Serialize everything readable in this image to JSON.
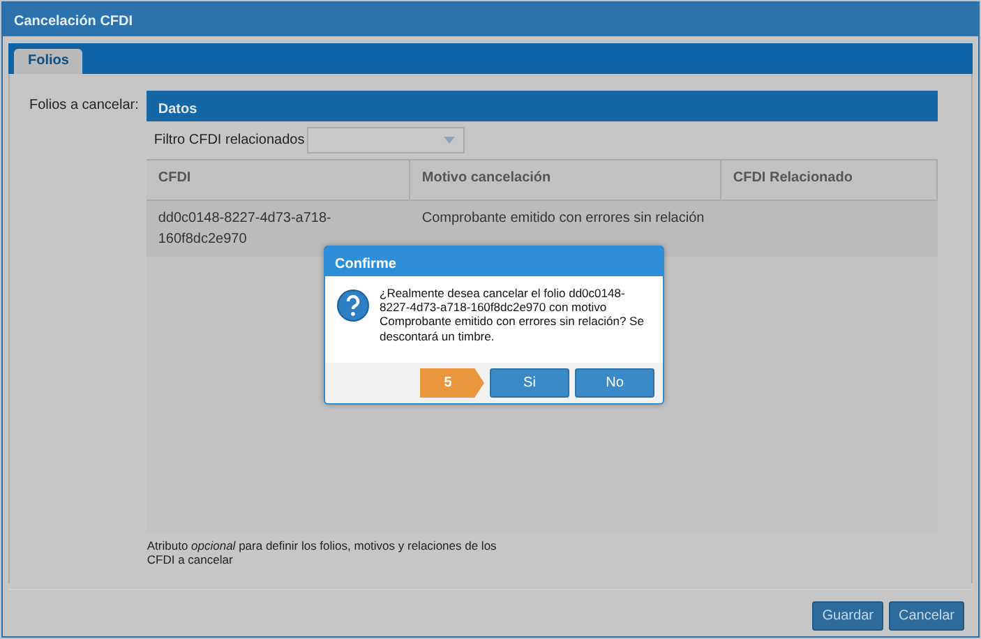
{
  "window": {
    "title": "Cancelación CFDI"
  },
  "tabs": [
    {
      "label": "Folios",
      "selected": true
    }
  ],
  "field_label": "Folios a cancelar:",
  "panel": {
    "title": "Datos",
    "filter": {
      "label": "Filtro CFDI relacionados"
    },
    "table": {
      "columns": [
        "CFDI",
        "Motivo cancelación",
        "CFDI Relacionado"
      ],
      "rows": [
        [
          "dd0c0148-8227-4d73-a718-160f8dc2e970",
          "Comprobante emitido con errores sin relación",
          ""
        ]
      ]
    },
    "hint": "Atributo *opcional* para definir los folios, motivos y relaciones de los CFDI a cancelar"
  },
  "buttons": [
    "Guardar",
    "Cancelar"
  ],
  "dialog": {
    "title": "Confirme",
    "message": "¿Realmente desea cancelar el folio dd0c0148-8227-4d73-a718-160f8dc2e970 con motivo Comprobante emitido con errores sin relación? Se descontará un timbre.",
    "countdown": "5",
    "buttons": [
      "Si",
      "No"
    ]
  }
}
